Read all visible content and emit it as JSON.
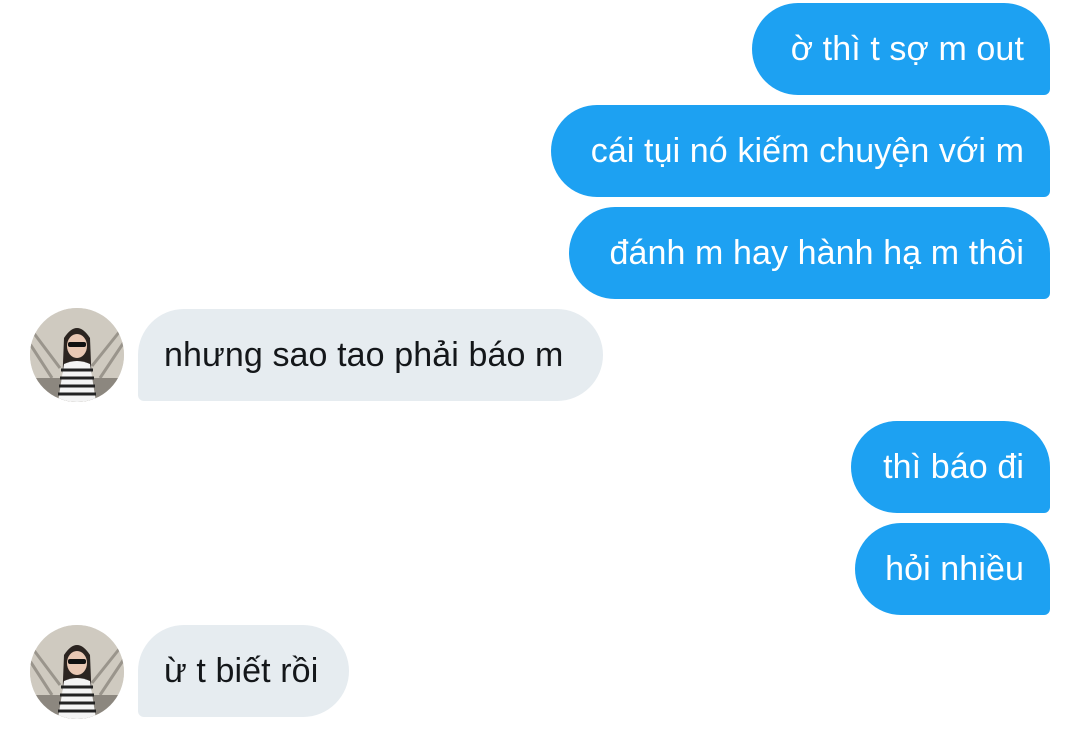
{
  "conversation": {
    "messages": [
      {
        "sender": "me",
        "text": "ờ thì t sợ m out"
      },
      {
        "sender": "me",
        "text": "cái tụi nó kiếm chuyện với m"
      },
      {
        "sender": "me",
        "text": "đánh m hay hành hạ m thôi"
      },
      {
        "sender": "other",
        "text": "nhưng sao tao phải báo m"
      },
      {
        "sender": "me",
        "text": "thì báo đi"
      },
      {
        "sender": "me",
        "text": "hỏi nhiều"
      },
      {
        "sender": "other",
        "text": "ừ t biết rồi"
      }
    ]
  },
  "colors": {
    "outgoing_bubble": "#1da1f2",
    "incoming_bubble": "#e6ecf0",
    "outgoing_text": "#ffffff",
    "incoming_text": "#14171a"
  },
  "icons": {
    "avatar": "contact-avatar-photo"
  }
}
